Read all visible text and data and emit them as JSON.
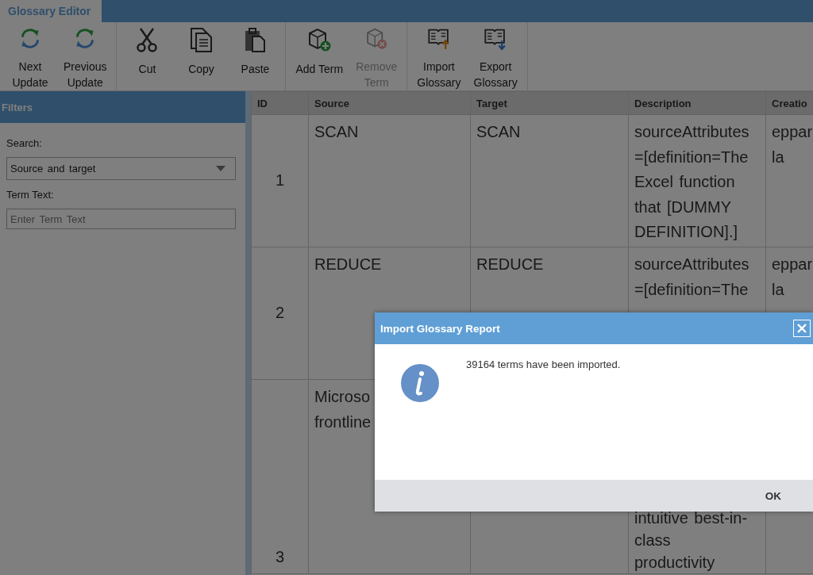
{
  "app_tab": {
    "label": "Glossary Editor",
    "selected": true
  },
  "toolbar": {
    "groups": [
      [
        {
          "kind": "next",
          "label": [
            "Next",
            "Update"
          ],
          "disabled": false
        },
        {
          "kind": "previous",
          "label": [
            "Previous",
            "Update"
          ],
          "disabled": false
        }
      ],
      [
        {
          "kind": "cut",
          "label": [
            "Cut"
          ],
          "disabled": false
        },
        {
          "kind": "copy",
          "label": [
            "Copy"
          ],
          "disabled": false
        },
        {
          "kind": "paste",
          "label": [
            "Paste"
          ],
          "disabled": false
        }
      ],
      [
        {
          "kind": "add",
          "label": [
            "Add Term"
          ],
          "disabled": false
        },
        {
          "kind": "remove",
          "label": [
            "Remove",
            "Term"
          ],
          "disabled": true
        }
      ],
      [
        {
          "kind": "import",
          "label": [
            "Import",
            "Glossary"
          ],
          "disabled": false
        },
        {
          "kind": "export",
          "label": [
            "Export",
            "Glossary"
          ],
          "disabled": false
        }
      ]
    ]
  },
  "filters": {
    "title": "Filters",
    "search_label": "Search:",
    "search_value": "Source and target",
    "term_label": "Term Text:",
    "term_placeholder": "Enter Term Text"
  },
  "table": {
    "columns": [
      "ID",
      "Source",
      "Target",
      "Description",
      "Creatio"
    ],
    "rows": [
      {
        "id": "1",
        "source": [
          "SCAN"
        ],
        "target": [
          "SCAN"
        ],
        "description": [
          "sourceAttributes",
          "=[definition=The",
          "Excel function",
          "that [DUMMY",
          "DEFINITION].]"
        ],
        "creation": [
          "eppar",
          "la"
        ]
      },
      {
        "id": "2",
        "source": [
          "REDUCE"
        ],
        "target": [
          "REDUCE"
        ],
        "description": [
          "sourceAttributes",
          "=[definition=The"
        ],
        "creation": [
          "eppar",
          "la"
        ]
      },
      {
        "id": "3",
        "source": [
          "Microso",
          "frontline"
        ],
        "target": [],
        "description": [
          "intuitive best-in-",
          "class",
          "productivity"
        ],
        "creation": []
      }
    ]
  },
  "dialog": {
    "title": "Import Glossary Report",
    "message": "39164 terms have been imported.",
    "button": "OK"
  }
}
